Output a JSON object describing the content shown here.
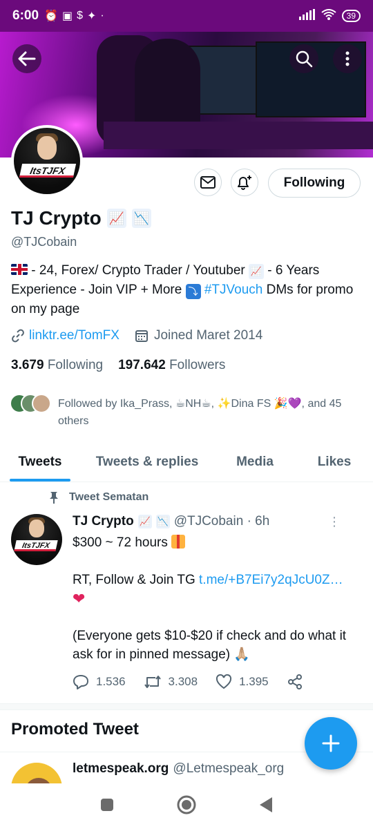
{
  "status_bar": {
    "time": "6:00",
    "battery": "39"
  },
  "profile": {
    "name": "TJ Crypto",
    "name_emoji_1": "📈",
    "name_emoji_2": "📉",
    "avatar_text": "ItsTJFX",
    "handle": "@TJCobain",
    "bio_part1": " - 24, Forex/ Crypto Trader / Youtuber ",
    "bio_part2": " - 6 Years Experience - Join VIP + More ",
    "bio_hashtag": "#TJVouch",
    "bio_part3": " DMs for promo on my page",
    "bio_arrow": "⤵",
    "link": "linktr.ee/TomFX",
    "joined": "Joined Maret 2014",
    "following_count": "3.679",
    "following_label": "Following",
    "followers_count": "197.642",
    "followers_label": "Followers",
    "followed_by": "Followed by Ika_Prass, ☕NH☕, ✨Dina FS 🎉💜, and 45 others",
    "follow_button": "Following"
  },
  "tabs": [
    {
      "label": "Tweets"
    },
    {
      "label": "Tweets & replies"
    },
    {
      "label": "Media"
    },
    {
      "label": "Likes"
    }
  ],
  "pinned_tweet": {
    "pinned_label": "Tweet Sematan",
    "author": "TJ Crypto",
    "handle_time": "@TJCobain · 6h",
    "line1": "$300 ~ 72 hours ",
    "line2_prefix": "RT, Follow & Join TG ",
    "line2_link": "t.me/+B7Ei7y2qJcU0Z…",
    "heart": "❤",
    "line3": "(Everyone gets $10-$20 if check and do  what it ask for in pinned message) 🙏🏼",
    "replies": "1.536",
    "retweets": "3.308",
    "likes": "1.395"
  },
  "promoted": {
    "heading": "Promoted Tweet",
    "author": "letmespeak.org",
    "handle": "@Letmespeak_org"
  },
  "colors": {
    "accent": "#1d9bf0",
    "status_bar": "#6b0a7c",
    "text_secondary": "#536471"
  },
  "icons": [
    "back-arrow-icon",
    "search-icon",
    "more-vertical-icon",
    "mail-icon",
    "bell-plus-icon",
    "pin-icon",
    "link-icon",
    "calendar-icon",
    "reply-icon",
    "retweet-icon",
    "like-icon",
    "share-icon",
    "compose-plus-icon"
  ]
}
